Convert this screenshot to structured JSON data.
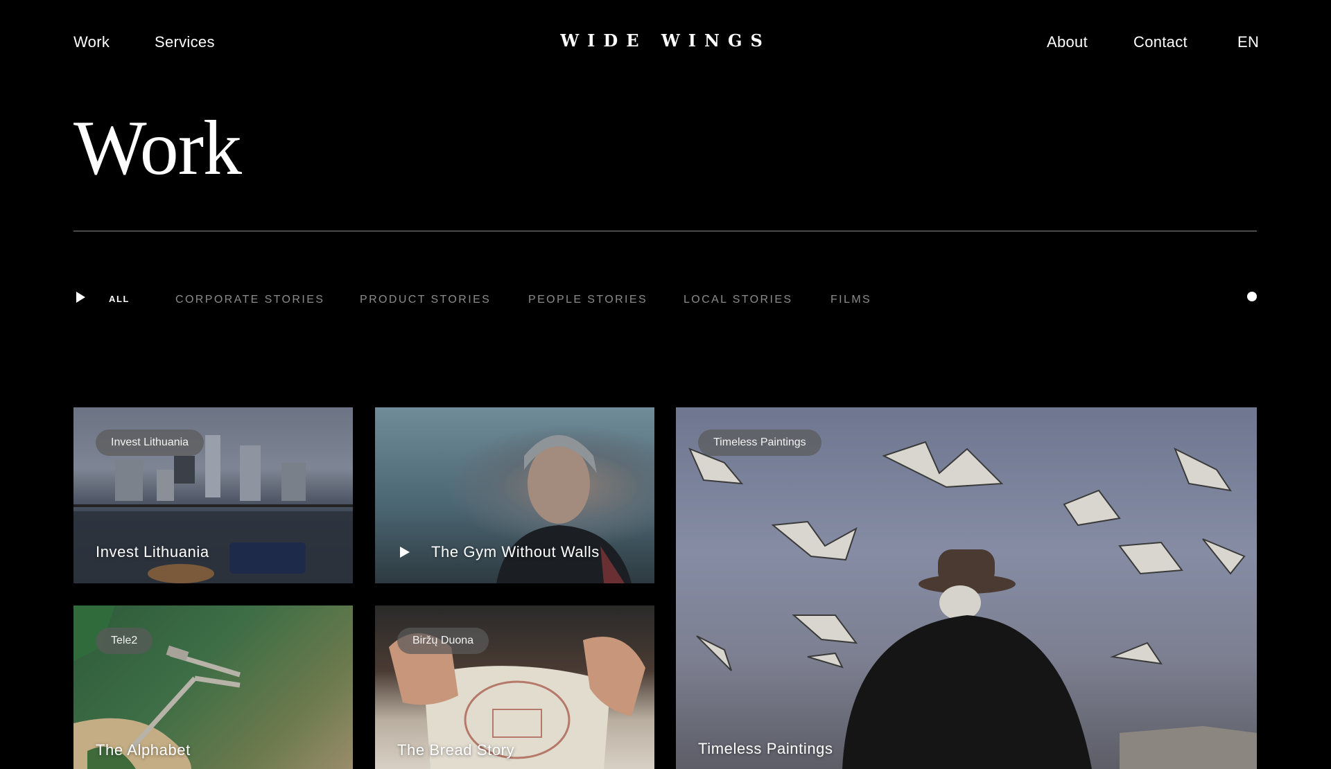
{
  "header": {
    "nav_left": [
      "Work",
      "Services"
    ],
    "logo": "WIDE WINGS",
    "nav_right": [
      "About",
      "Contact",
      "EN"
    ]
  },
  "page": {
    "title": "Work"
  },
  "filters": {
    "active": "ALL",
    "items": [
      "CORPORATE STORIES",
      "PRODUCT STORIES",
      "PEOPLE STORIES",
      "LOCAL STORIES",
      "FILMS"
    ]
  },
  "cards": [
    {
      "badge": "Invest Lithuania",
      "title": "Invest Lithuania"
    },
    {
      "title": "The Gym Without Walls"
    },
    {
      "badge": "Timeless Paintings",
      "title": "Timeless Paintings"
    },
    {
      "badge": "Tele2",
      "title": "The Alphabet"
    },
    {
      "badge": "Biržų Duona",
      "title": "The Bread Story"
    }
  ]
}
